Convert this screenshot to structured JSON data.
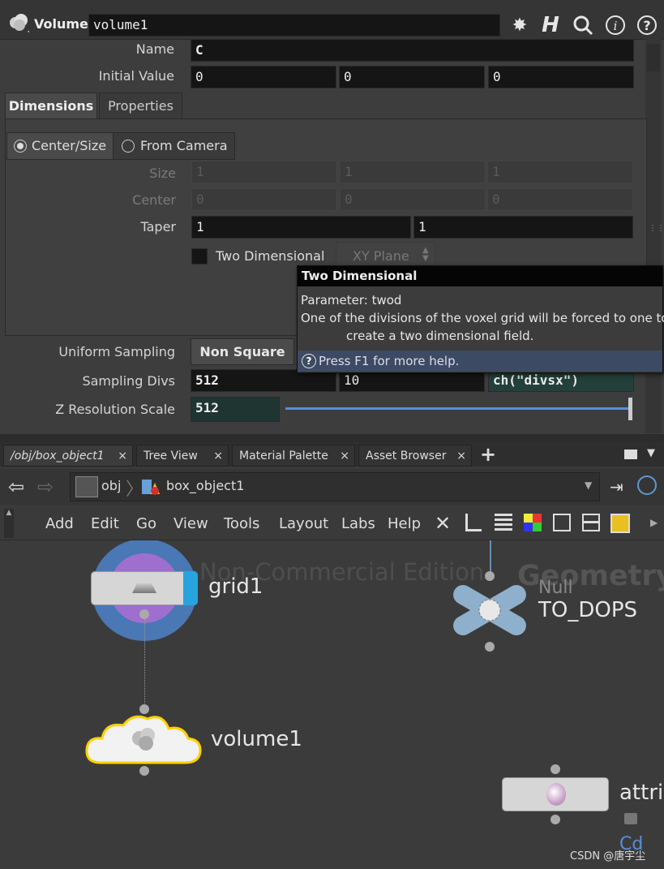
{
  "header": {
    "node_type": "Volume",
    "node_name": "volume1",
    "icons": [
      "gear-icon",
      "help-h-icon",
      "search-icon",
      "info-icon",
      "question-icon"
    ]
  },
  "params": {
    "name": {
      "label": "Name",
      "value": "C"
    },
    "initial_value": {
      "label": "Initial Value",
      "values": [
        "0",
        "0",
        "0"
      ]
    },
    "tabs": [
      "Dimensions",
      "Properties"
    ],
    "mode_options": [
      "Center/Size",
      "From Camera"
    ],
    "size": {
      "label": "Size",
      "values": [
        "1",
        "1",
        "1"
      ]
    },
    "center": {
      "label": "Center",
      "values": [
        "0",
        "0",
        "0"
      ]
    },
    "taper": {
      "label": "Taper",
      "values": [
        "1",
        "1"
      ]
    },
    "two_dimensional": {
      "label": "Two Dimensional",
      "plane": "XY Plane"
    },
    "uniform_sampling": {
      "label": "Uniform Sampling",
      "value": "Non Square"
    },
    "sampling_divs": {
      "label": "Sampling Divs",
      "values": [
        "512",
        "10",
        "ch(\"divsx\")"
      ]
    },
    "z_resolution": {
      "label": "Z Resolution Scale",
      "value": "512"
    }
  },
  "tooltip": {
    "title": "Two Dimensional",
    "param": "Parameter: twod",
    "desc_line1": "One of the divisions of the voxel grid will be forced to one to",
    "desc_line2": "create a two dimensional field.",
    "help": "Press F1 for more help."
  },
  "network": {
    "tabs": [
      "/obj/box_object1",
      "Tree View",
      "Material Palette",
      "Asset Browser"
    ],
    "path": [
      "obj",
      "box_object1"
    ],
    "menu": [
      "Add",
      "Edit",
      "Go",
      "View",
      "Tools",
      "Layout",
      "Labs",
      "Help"
    ],
    "watermark": "Non-Commercial Edition",
    "context": "Geometry",
    "nodes": {
      "grid": "grid1",
      "volume": "volume1",
      "null_type": "Null",
      "null_name": "TO_DOPS",
      "attrib": "attri",
      "attrib_sub": "Cd"
    },
    "credit": "CSDN @唐宇尘"
  },
  "colors": {
    "accent": "#ffd000",
    "tooltip_help_bg": "#3d4a63",
    "field_bg": "#151515"
  }
}
